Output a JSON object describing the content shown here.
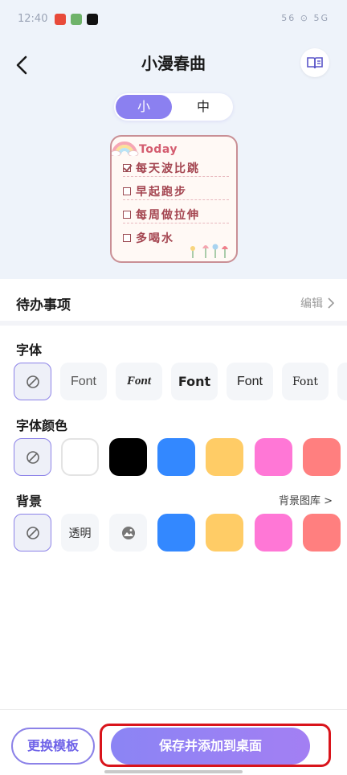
{
  "status_bar": {
    "time": "12:40",
    "right_text": "56 ⊙ 5G"
  },
  "header": {
    "title": "小漫春曲"
  },
  "size_toggle": {
    "small": "小",
    "medium": "中"
  },
  "preview": {
    "heading": "Today",
    "items": [
      {
        "text": "每天波比跳",
        "checked": true
      },
      {
        "text": "早起跑步",
        "checked": false
      },
      {
        "text": "每周做拉伸",
        "checked": false
      },
      {
        "text": "多喝水",
        "checked": false
      }
    ]
  },
  "todo": {
    "label": "待办事项",
    "edit": "编辑"
  },
  "font_row": {
    "title": "字体",
    "options": [
      "Font",
      "Font",
      "Font",
      "Font",
      "Font"
    ]
  },
  "font_color_row": {
    "title": "字体颜色",
    "colors": [
      "#ffffff",
      "#000000",
      "#3388ff",
      "#ffcc66",
      "#ff77d6",
      "#ff7f7f"
    ]
  },
  "background_row": {
    "title": "背景",
    "gallery_link": "背景图库 >",
    "transparent_label": "透明",
    "colors": [
      "#3388ff",
      "#ffcc66",
      "#ff77d6",
      "#ff7f7f"
    ]
  },
  "bottom": {
    "swap": "更换模板",
    "save": "保存并添加到桌面"
  },
  "colors": {
    "accent": "#8b80f0",
    "annotation": "#d9141b"
  }
}
